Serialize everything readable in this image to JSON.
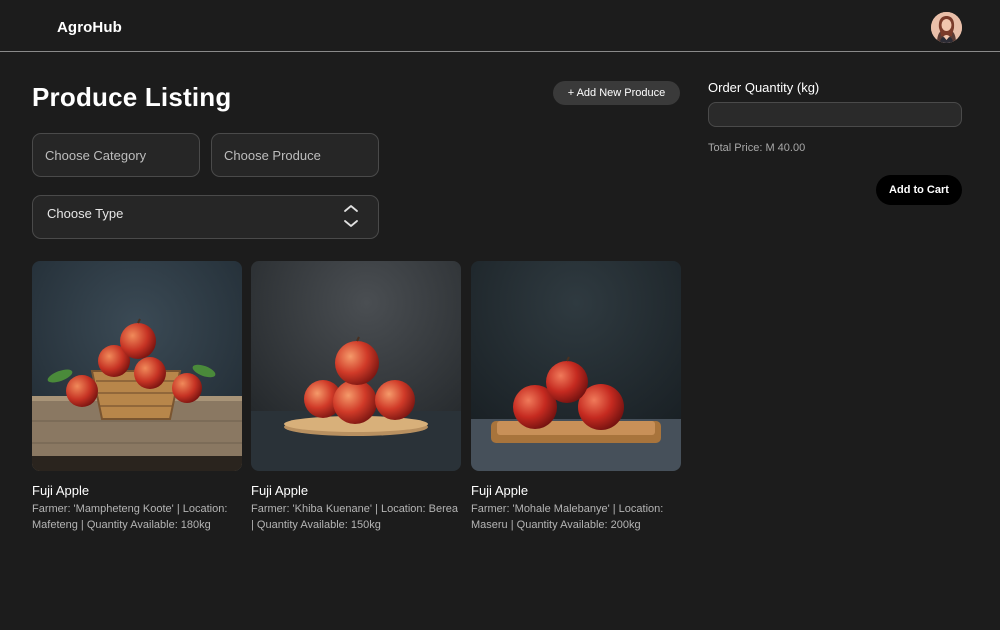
{
  "app": {
    "brand": "AgroHub"
  },
  "header": {
    "avatar_icon": "user-avatar-icon"
  },
  "page": {
    "title": "Produce Listing",
    "add_button_label": "+ Add New Produce"
  },
  "filters": {
    "category_placeholder": "Choose Category",
    "produce_placeholder": "Choose Produce",
    "type_placeholder": "Choose Type"
  },
  "products": [
    {
      "name": "Fuji Apple",
      "description": "Farmer: 'Mampheteng Koote' | Location: Mafeteng | Quantity Available: 180kg",
      "image_icon": "apples-in-basket-photo"
    },
    {
      "name": "Fuji Apple",
      "description": "Farmer: 'Khiba Kuenane' | Location: Berea | Quantity Available: 150kg",
      "image_icon": "apples-on-plate-photo"
    },
    {
      "name": "Fuji Apple",
      "description": "Farmer: 'Mohale Malebanye' | Location: Maseru | Quantity Available: 200kg",
      "image_icon": "apples-on-tray-photo"
    }
  ],
  "order": {
    "quantity_label": "Order Quantity (kg)",
    "quantity_value": "",
    "total_price": "Total Price: M 40.00",
    "add_to_cart_label": "Add to Cart"
  },
  "colors": {
    "background": "#1c1c1c",
    "field": "#262626",
    "button_dark": "#000000",
    "button_secondary": "#3a3a3a"
  }
}
